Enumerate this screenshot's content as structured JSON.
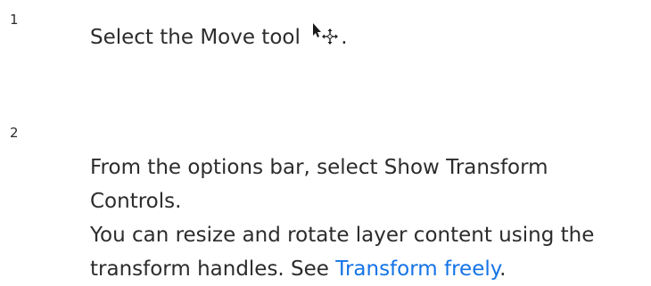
{
  "steps": [
    {
      "number": "1",
      "text": "Select the Move tool",
      "icon": "move-tool-icon",
      "after_icon": "."
    },
    {
      "number": "2",
      "line1": "From the options bar, select Show Transform",
      "line2": "Controls.",
      "line3": "You can resize and rotate layer content using the",
      "line4_prefix": "transform handles. See ",
      "link_text": "Transform freely",
      "line4_suffix": "."
    }
  ],
  "colors": {
    "text": "#2c2c2c",
    "link": "#1473e6"
  }
}
